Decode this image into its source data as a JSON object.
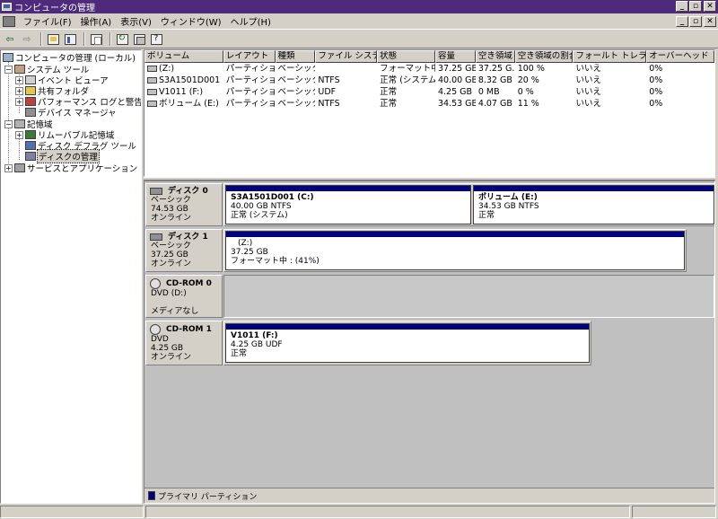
{
  "window": {
    "title": "コンピュータの管理",
    "buttons": {
      "minimize": "_",
      "restore": "▫",
      "close": "✕"
    }
  },
  "menu": {
    "items": [
      "ファイル(F)",
      "操作(A)",
      "表示(V)",
      "ウィンドウ(W)",
      "ヘルプ(H)"
    ]
  },
  "toolbar": {
    "back_icon": "back-arrow-icon",
    "forward_icon": "forward-arrow-icon"
  },
  "tree": {
    "root": "コンピュータの管理 (ローカル)",
    "system_tools": "システム ツール",
    "event_viewer": "イベント ビューア",
    "shared_folders": "共有フォルダ",
    "performance": "パフォーマンス ログと警告",
    "device_manager": "デバイス マネージャ",
    "storage": "記憶域",
    "removable": "リムーバブル記憶域",
    "defrag": "ディスク デフラグ ツール",
    "disk_mgmt": "ディスクの管理",
    "services": "サービスとアプリケーション"
  },
  "volumes": {
    "columns": [
      "ボリューム",
      "レイアウト",
      "種類",
      "ファイル システム",
      "状態",
      "容量",
      "空き領域",
      "空き領域の割合",
      "フォールト トレランス",
      "オーバーヘッド"
    ],
    "rows": [
      [
        "(Z:)",
        "パーティション",
        "ベーシック",
        "",
        "フォーマット中 : ...",
        "37.25 GB",
        "37.25 G...",
        "100 %",
        "いいえ",
        "0%"
      ],
      [
        "S3A1501D001 (C:)",
        "パーティション",
        "ベーシック",
        "NTFS",
        "正常 (システム)",
        "40.00 GB",
        "8.32 GB",
        "20 %",
        "いいえ",
        "0%"
      ],
      [
        "V1011 (F:)",
        "パーティション",
        "ベーシック",
        "UDF",
        "正常",
        "4.25 GB",
        "0 MB",
        "0 %",
        "いいえ",
        "0%"
      ],
      [
        "ボリューム (E:)",
        "パーティション",
        "ベーシック",
        "NTFS",
        "正常",
        "34.53 GB",
        "4.07 GB",
        "11 %",
        "いいえ",
        "0%"
      ]
    ]
  },
  "disks": {
    "disk0": {
      "name": "ディスク 0",
      "type": "ベーシック",
      "size": "74.53 GB",
      "status": "オンライン",
      "p1": {
        "name": "S3A1501D001  (C:)",
        "size": "40.00 GB NTFS",
        "status": "正常 (システム)"
      },
      "p2": {
        "name": "ボリューム  (E:)",
        "size": "34.53 GB NTFS",
        "status": "正常"
      }
    },
    "disk1": {
      "name": "ディスク 1",
      "type": "ベーシック",
      "size": "37.25 GB",
      "status": "オンライン",
      "p1": {
        "name": "(Z:)",
        "size": "37.25 GB",
        "status": "フォーマット中 : (41%)"
      }
    },
    "cdrom0": {
      "name": "CD-ROM 0",
      "type": "DVD (D:)",
      "status": "メディアなし"
    },
    "cdrom1": {
      "name": "CD-ROM 1",
      "type": "DVD",
      "size": "4.25 GB",
      "status": "オンライン",
      "p1": {
        "name": "V1011  (F:)",
        "size": "4.25 GB UDF",
        "status": "正常"
      }
    }
  },
  "legend": {
    "primary": "プライマリ パーティション",
    "color": "#000080"
  },
  "colors": {
    "titlebar": "#4d2a7c",
    "partition_bar": "#000080"
  }
}
